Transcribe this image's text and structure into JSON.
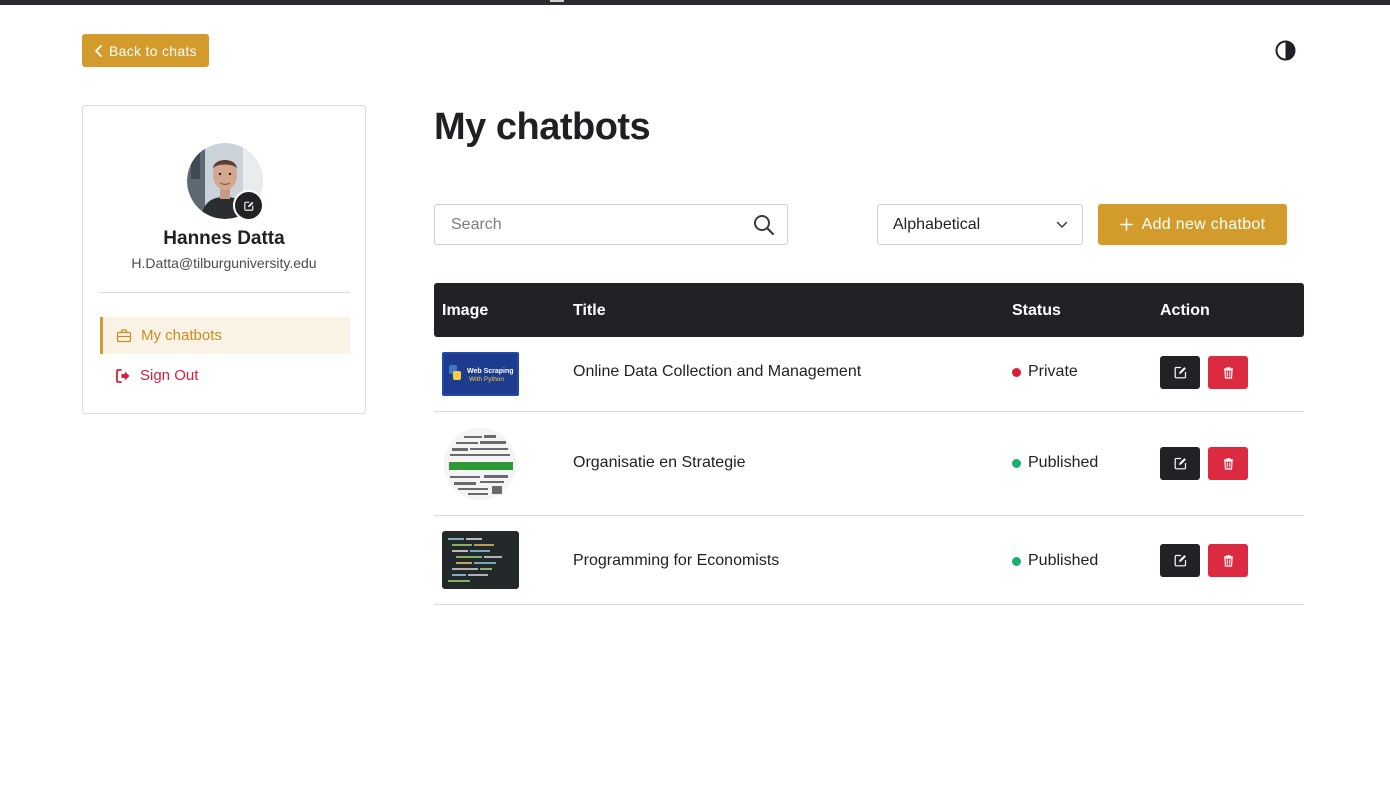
{
  "header": {
    "back_label": "Back to chats",
    "theme_toggle_icon": "contrast-icon"
  },
  "profile": {
    "name": "Hannes Datta",
    "email": "H.Datta@tilburguniversity.edu",
    "nav": [
      {
        "label": "My chatbots",
        "icon": "briefcase-icon",
        "active": true
      },
      {
        "label": "Sign Out",
        "icon": "sign-out-icon",
        "active": false
      }
    ]
  },
  "main": {
    "title": "My chatbots",
    "search_placeholder": "Search",
    "sort_selected": "Alphabetical",
    "add_label": "Add new chatbot"
  },
  "table": {
    "headers": [
      "Image",
      "Title",
      "Status",
      "Action"
    ],
    "rows": [
      {
        "image_caption": "Web Scraping With Python",
        "image_line1": "Web Scraping",
        "image_line2": "With Python",
        "title": "Online Data Collection and Management",
        "status": "Private"
      },
      {
        "image_caption": "strategy word cloud",
        "title": "Organisatie en Strategie",
        "status": "Published"
      },
      {
        "image_caption": "code screen",
        "title": "Programming for Economists",
        "status": "Published"
      }
    ]
  },
  "colors": {
    "accent": "#d29b2c",
    "dark": "#212226",
    "danger": "#dc2a41",
    "private": "#d6203a",
    "published": "#17b16e"
  }
}
